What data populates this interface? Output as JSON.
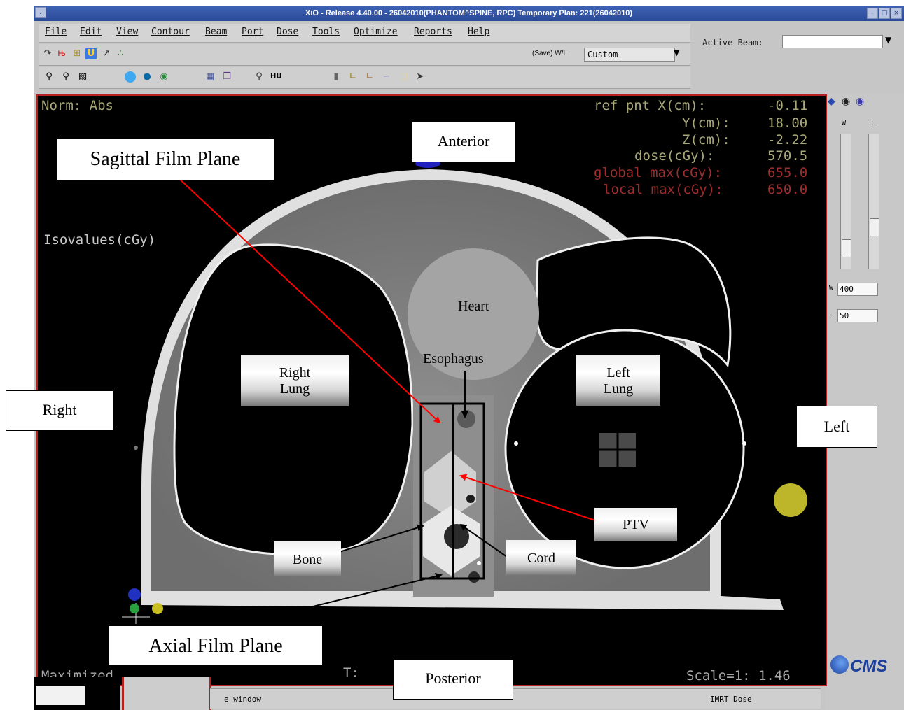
{
  "window": {
    "title": "XiO - Release 4.40.00 - 26042010(PHANTOM^SPINE, RPC) Temporary Plan: 221(26042010)"
  },
  "menu": [
    "File",
    "Edit",
    "View",
    "Contour",
    "Beam",
    "Port",
    "Dose",
    "Tools",
    "Optimize",
    "Reports",
    "Help"
  ],
  "toolbar": {
    "save_wl_label": "(Save) W/L",
    "wl_preset": "Custom",
    "active_beam_label": "Active Beam:",
    "hu_label": "HU"
  },
  "overlay": {
    "norm": "Norm: Abs",
    "ref_pnt_x_label": "ref pnt X(cm):",
    "ref_pnt_x": "-0.11",
    "y_label": "Y(cm):",
    "y": "18.00",
    "z_label": "Z(cm):",
    "z": "-2.22",
    "dose_label": "dose(cGy):",
    "dose": "570.5",
    "global_max_label": "global max(cGy):",
    "global_max": "655.0",
    "local_max_label": "local max(cGy):",
    "local_max": "650.0",
    "isovalues": "Isovalues(cGy)",
    "maximized": "Maximized",
    "t_label": "T:",
    "scale": "Scale=1: 1.46"
  },
  "side_panel": {
    "w_label": "W",
    "l_label": "L",
    "w_value": "400",
    "l_value": "50",
    "logo": "CMS"
  },
  "status": {
    "left": "e window",
    "right": "IMRT Dose"
  },
  "labels": {
    "anterior": "Anterior",
    "posterior": "Posterior",
    "right": "Right",
    "left": "Left",
    "sagittal": "Sagittal Film Plane",
    "axial": "Axial Film Plane",
    "heart": "Heart",
    "esophagus": "Esophagus",
    "right_lung_1": "Right",
    "right_lung_2": "Lung",
    "left_lung_1": "Left",
    "left_lung_2": "Lung",
    "ptv": "PTV",
    "bone": "Bone",
    "cord": "Cord"
  },
  "colors": {
    "title_bar": "#2f52a8",
    "overlay_text": "#b9b992",
    "overlay_max": "#a93030",
    "sagittal_line": "#ff0000",
    "viewport_border": "#b52020"
  }
}
